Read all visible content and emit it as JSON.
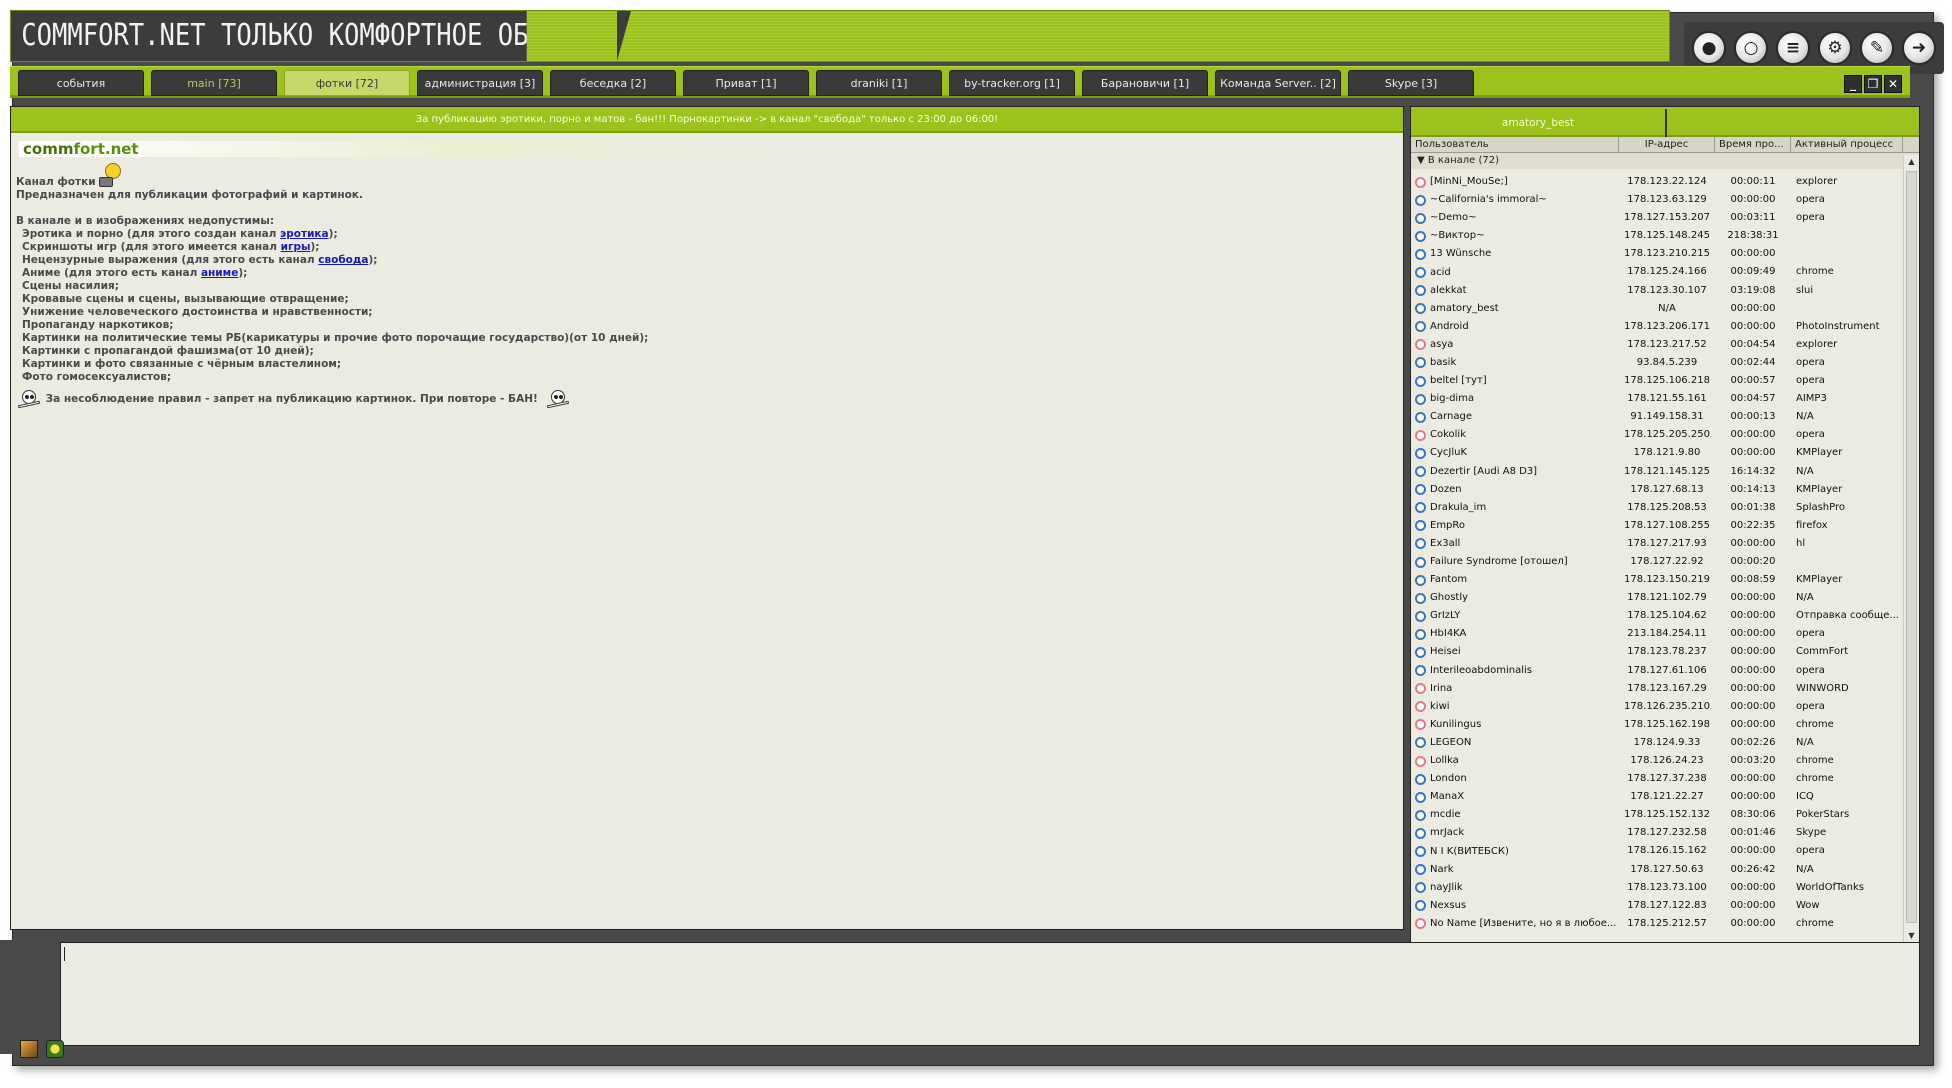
{
  "title": "COMMFORT.NET ТОЛЬКО КОМФОРТНОЕ ОБЩЕНИЕ",
  "top_icons": [
    "user-status-icon",
    "chat-bubble-icon",
    "list-icon",
    "settings-gear-icon",
    "edit-profile-icon",
    "exit-icon"
  ],
  "tabs": [
    {
      "label": "события",
      "style": "normal"
    },
    {
      "label": "main [73]",
      "style": "dim"
    },
    {
      "label": "фотки [72]",
      "style": "active"
    },
    {
      "label": "администрация [3]",
      "style": "normal"
    },
    {
      "label": "беседка [2]",
      "style": "normal"
    },
    {
      "label": "Приват [1]",
      "style": "normal"
    },
    {
      "label": "draniki [1]",
      "style": "normal"
    },
    {
      "label": "by-tracker.org [1]",
      "style": "normal"
    },
    {
      "label": "Барановичи [1]",
      "style": "normal"
    },
    {
      "label": "Команда Server.. [2]",
      "style": "normal"
    },
    {
      "label": "Skype [3]",
      "style": "normal"
    }
  ],
  "chat": {
    "topic": "За публикацию эротики, порно и матов - бан!!! Порнокартинки -> в канал \"свобода\" только с 23:00 до 06:00!",
    "logo_pre": "comm",
    "logo_post": "fort.net",
    "channel_label": "Канал фотки",
    "purpose": "Предназначен для публикации фотографий и картинок.",
    "forbidden_head": "В канале и в изображениях недопустимы:",
    "rule1_pre": "Эротика и порно (для этого создан канал ",
    "rule1_link": "эротика",
    "rule1_post": ");",
    "rule2_pre": "Скриншоты игр (для этого имеется канал ",
    "rule2_link": "игры",
    "rule2_post": ");",
    "rule3_pre": "Нецензурные выражения (для этого есть канал ",
    "rule3_link": "свобода",
    "rule3_post": ");",
    "rule4_pre": "Аниме (для этого есть канал ",
    "rule4_link": "аниме",
    "rule4_post": ");",
    "rules_rest": [
      "Сцены насилия;",
      "Кровавые сцены и сцены, вызывающие отвращение;",
      "Унижение человеческого достоинства и нравственности;",
      "Пропаганду наркотиков;",
      "Картинки на политические темы РБ(карикатуры и прочие фото порочащие государство)(от 10 дней);",
      "Картинки с пропагандой фашизма(от 10 дней);",
      "Картинки и фото связанные с чёрным властелином;",
      "Фото гомосексуалистов;"
    ],
    "warning": "За несоблюдение правил - запрет на публикацию картинок. При повторе - БАН!"
  },
  "userpanel": {
    "tab_label": "amatory_best",
    "columns": [
      "Пользователь",
      "IP-адрес",
      "Время про...",
      "Активный процесс"
    ],
    "group_label": "В канале (72)",
    "users": [
      {
        "name": "[MinNi_MouSe;]",
        "ip": "178.123.22.124",
        "time": "00:00:11",
        "proc": "explorer",
        "g": "f"
      },
      {
        "name": "~California's immoral~",
        "ip": "178.123.63.129",
        "time": "00:00:00",
        "proc": "opera",
        "g": "m"
      },
      {
        "name": "~Demo~",
        "ip": "178.127.153.207",
        "time": "00:03:11",
        "proc": "opera",
        "g": "m"
      },
      {
        "name": "~Виктор~",
        "ip": "178.125.148.245",
        "time": "218:38:31",
        "proc": "",
        "g": "m"
      },
      {
        "name": "13 Wünsche",
        "ip": "178.123.210.215",
        "time": "00:00:00",
        "proc": "",
        "g": "m"
      },
      {
        "name": "acid",
        "ip": "178.125.24.166",
        "time": "00:09:49",
        "proc": "chrome",
        "g": "m"
      },
      {
        "name": "alekkat",
        "ip": "178.123.30.107",
        "time": "03:19:08",
        "proc": "slui",
        "g": "m"
      },
      {
        "name": "amatory_best",
        "ip": "N/A",
        "time": "00:00:00",
        "proc": "",
        "g": "m"
      },
      {
        "name": "Android",
        "ip": "178.123.206.171",
        "time": "00:00:00",
        "proc": "PhotoInstrument",
        "g": "m"
      },
      {
        "name": "asya",
        "ip": "178.123.217.52",
        "time": "00:04:54",
        "proc": "explorer",
        "g": "f"
      },
      {
        "name": "basik",
        "ip": "93.84.5.239",
        "time": "00:02:44",
        "proc": "opera",
        "g": "m"
      },
      {
        "name": "beltel [тут]",
        "ip": "178.125.106.218",
        "time": "00:00:57",
        "proc": "opera",
        "g": "m"
      },
      {
        "name": "big-dima",
        "ip": "178.121.55.161",
        "time": "00:04:57",
        "proc": "AIMP3",
        "g": "m"
      },
      {
        "name": "Carnage",
        "ip": "91.149.158.31",
        "time": "00:00:13",
        "proc": "N/A",
        "g": "m"
      },
      {
        "name": "Cokolik",
        "ip": "178.125.205.250",
        "time": "00:00:00",
        "proc": "opera",
        "g": "f"
      },
      {
        "name": "CycJluK",
        "ip": "178.121.9.80",
        "time": "00:00:00",
        "proc": "KMPlayer",
        "g": "m"
      },
      {
        "name": "Dezertir [Audi A8 D3]",
        "ip": "178.121.145.125",
        "time": "16:14:32",
        "proc": "N/A",
        "g": "m"
      },
      {
        "name": "Dozen",
        "ip": "178.127.68.13",
        "time": "00:14:13",
        "proc": "KMPlayer",
        "g": "m"
      },
      {
        "name": "Drakula_im",
        "ip": "178.125.208.53",
        "time": "00:01:38",
        "proc": "SplashPro",
        "g": "m"
      },
      {
        "name": "EmpRo",
        "ip": "178.127.108.255",
        "time": "00:22:35",
        "proc": "firefox",
        "g": "m"
      },
      {
        "name": "Ex3all",
        "ip": "178.127.217.93",
        "time": "00:00:00",
        "proc": "hl",
        "g": "m"
      },
      {
        "name": "Failure Syndrome [отошел]",
        "ip": "178.127.22.92",
        "time": "00:00:20",
        "proc": "",
        "g": "m"
      },
      {
        "name": "Fantom",
        "ip": "178.123.150.219",
        "time": "00:08:59",
        "proc": "KMPlayer",
        "g": "m"
      },
      {
        "name": "Ghostly",
        "ip": "178.121.102.79",
        "time": "00:00:00",
        "proc": "N/A",
        "g": "m"
      },
      {
        "name": "GrIzLY",
        "ip": "178.125.104.62",
        "time": "00:00:00",
        "proc": "Отправка сообще...",
        "g": "m"
      },
      {
        "name": "HbI4KA",
        "ip": "213.184.254.11",
        "time": "00:00:00",
        "proc": "opera",
        "g": "m"
      },
      {
        "name": "Heisei",
        "ip": "178.123.78.237",
        "time": "00:00:00",
        "proc": "CommFort",
        "g": "m"
      },
      {
        "name": "Interileoabdominalis",
        "ip": "178.127.61.106",
        "time": "00:00:00",
        "proc": "opera",
        "g": "m"
      },
      {
        "name": "Irina",
        "ip": "178.123.167.29",
        "time": "00:00:00",
        "proc": "WINWORD",
        "g": "f"
      },
      {
        "name": "kiwi",
        "ip": "178.126.235.210",
        "time": "00:00:00",
        "proc": "opera",
        "g": "f"
      },
      {
        "name": "Kunilingus",
        "ip": "178.125.162.198",
        "time": "00:00:00",
        "proc": "chrome",
        "g": "f"
      },
      {
        "name": "LEGEON",
        "ip": "178.124.9.33",
        "time": "00:02:26",
        "proc": "N/A",
        "g": "m"
      },
      {
        "name": "Lollka",
        "ip": "178.126.24.23",
        "time": "00:03:20",
        "proc": "chrome",
        "g": "f"
      },
      {
        "name": "London",
        "ip": "178.127.37.238",
        "time": "00:00:00",
        "proc": "chrome",
        "g": "m"
      },
      {
        "name": "ManaX",
        "ip": "178.121.22.27",
        "time": "00:00:00",
        "proc": "ICQ",
        "g": "m"
      },
      {
        "name": "mcdie",
        "ip": "178.125.152.132",
        "time": "08:30:06",
        "proc": "PokerStars",
        "g": "m"
      },
      {
        "name": "mrJack",
        "ip": "178.127.232.58",
        "time": "00:01:46",
        "proc": "Skype",
        "g": "m"
      },
      {
        "name": "N I K(ВИТЕБСК)",
        "ip": "178.126.15.162",
        "time": "00:00:00",
        "proc": "opera",
        "g": "m"
      },
      {
        "name": "Nark",
        "ip": "178.127.50.63",
        "time": "00:26:42",
        "proc": "N/A",
        "g": "m"
      },
      {
        "name": "nayJlik",
        "ip": "178.123.73.100",
        "time": "00:00:00",
        "proc": "WorldOfTanks",
        "g": "m"
      },
      {
        "name": "Nexsus",
        "ip": "178.127.122.83",
        "time": "00:00:00",
        "proc": "Wow",
        "g": "m"
      },
      {
        "name": "No Name [Извените, но я в любое...",
        "ip": "178.125.212.57",
        "time": "00:00:00",
        "proc": "chrome",
        "g": "f"
      }
    ]
  }
}
